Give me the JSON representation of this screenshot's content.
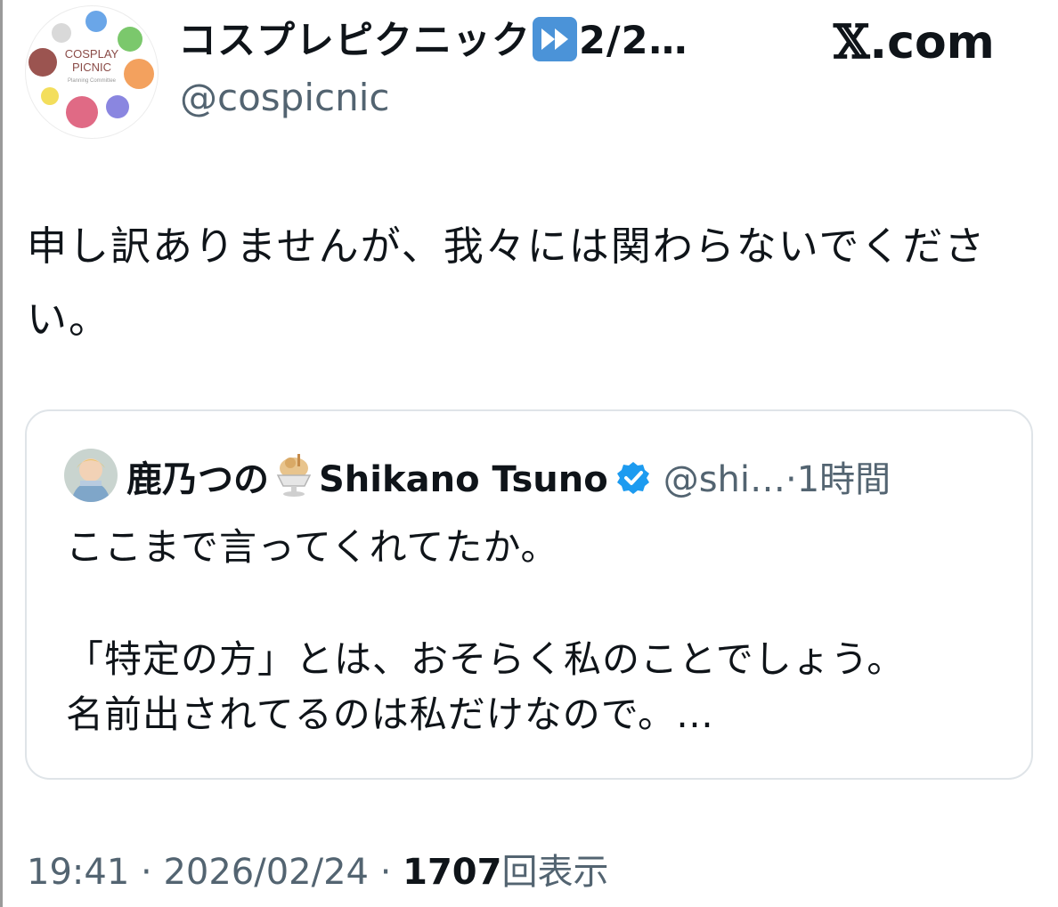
{
  "tweet": {
    "author_name": "コスプレピクニック",
    "author_name_suffix": "2/2…",
    "author_handle": "@cospicnic",
    "site_label": ".com",
    "logo_lines": [
      "COSPLAY",
      "PICNIC",
      "Planning Committee"
    ],
    "text": "申し訳ありませんが、我々には関わらないでください。",
    "time": "19:41",
    "date": "2026/02/24",
    "views_count": "1707",
    "views_label": "回表示",
    "sep": " · "
  },
  "quote": {
    "author_name_ja": "鹿乃つの",
    "author_name_en": "Shikano Tsuno",
    "handle": "@shi…",
    "sep": "·",
    "time": "1時間",
    "line1": "ここまで言ってくれてたか。",
    "line2": "「特定の方」とは、おそらく私のことでしょう。",
    "line3": "名前出されてるのは私だけなので。…"
  },
  "icons": {
    "avatar": "cosplay-picnic-logo",
    "emoji_fast_forward": "fast-forward-icon",
    "x_logo": "x-logo-icon",
    "quote_avatar": "user-avatar",
    "emoji_icecream": "ice-cream-icon",
    "verified": "verified-badge-icon"
  },
  "colors": {
    "text": "#0f1419",
    "secondary": "#536471",
    "verified_blue": "#1d9bf0",
    "border": "#dfe4e8"
  }
}
